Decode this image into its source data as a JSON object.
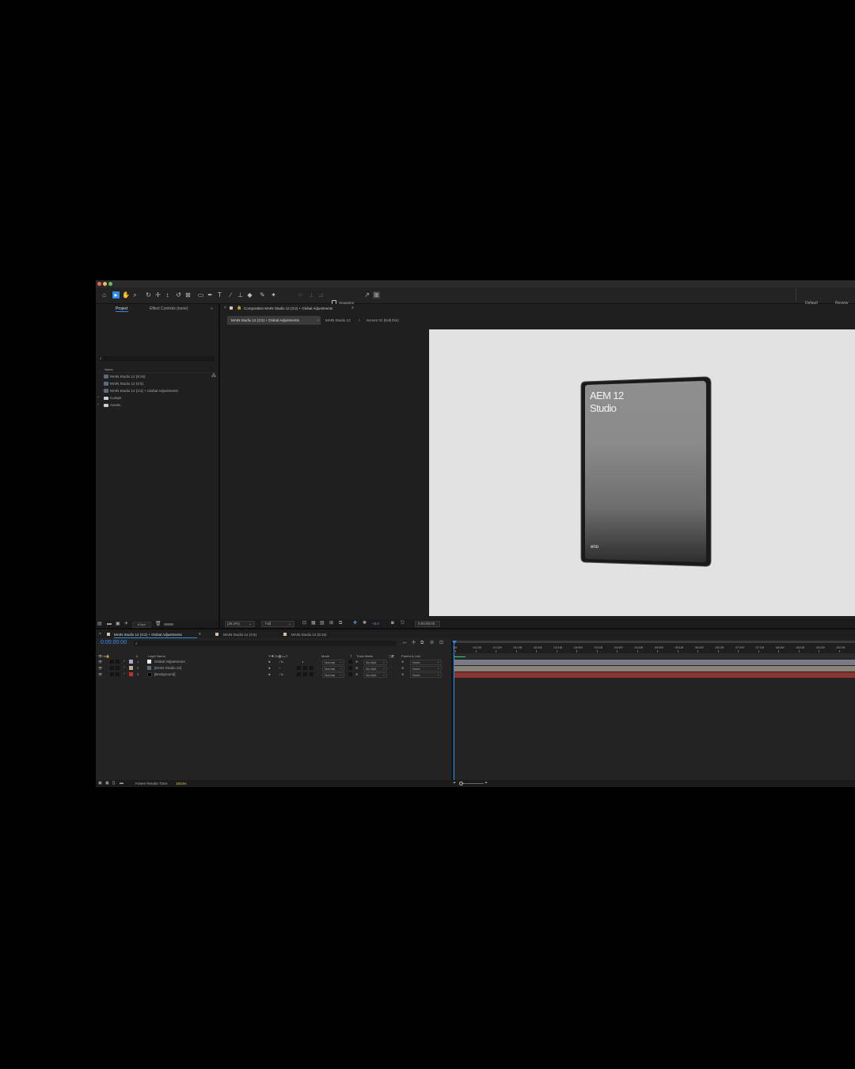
{
  "toolbar": {
    "snapping_label": "Snapping",
    "workspace_default": "Default",
    "workspace_review": "Review"
  },
  "project_panel": {
    "tab_project": "Project",
    "tab_effect_controls": "Effect Controls (none)",
    "search_placeholder": "",
    "column_name": "Name",
    "items": [
      {
        "name": "MAIN Studio 12 (9:16)",
        "type": "comp"
      },
      {
        "name": "MAIN Studio 12 (4:5)",
        "type": "comp"
      },
      {
        "name": "MAIN Studio 12 (3:2) + Global Adjustments",
        "type": "comp"
      },
      {
        "name": "Comps",
        "type": "folder"
      },
      {
        "name": "Assets",
        "type": "folder"
      }
    ],
    "bpc": "8 bpc"
  },
  "composition_panel": {
    "header": "Composition MAIN Studio 12 (3:2) + Global Adjustments",
    "breadcrumbs": [
      "MAIN Studio 12 (3:2) + Global Adjustments",
      "MAIN Studio 12",
      "Screen 01 (Edit this)"
    ],
    "zoom": "(28.2%)",
    "resolution": "Full",
    "timecode": "0:00:00:00",
    "exposure": "+0.0"
  },
  "canvas": {
    "title_line1": "AEM 12",
    "title_line2": "Studio",
    "logo": "eno",
    "background": "#e2e2e2"
  },
  "timeline": {
    "tabs": [
      "MAIN Studio 12 (3:2) + Global Adjustments",
      "MAIN Studio 12 (4:5)",
      "MAIN Studio 12 (9:16)"
    ],
    "timecode": "0:00:00:00",
    "columns": {
      "num": "#",
      "layer_name": "Layer Name",
      "mode": "Mode",
      "t": "T",
      "track_matte": "Track Matte",
      "parent": "Parent & Link"
    },
    "layers": [
      {
        "num": "1",
        "name": "Global Adjustments",
        "mode": "Normal",
        "matte": "No Mat",
        "parent": "None",
        "color": "#a8a8c8",
        "bar_color": "#7c7c88"
      },
      {
        "num": "2",
        "name": "[MAIN Studio 12]",
        "mode": "Normal",
        "matte": "No Mat",
        "parent": "None",
        "color": "#c8a890",
        "bar_color": "#8a8278"
      },
      {
        "num": "3",
        "name": "[Background]",
        "mode": "Normal",
        "matte": "No Mat",
        "parent": "None",
        "color": "#c03030",
        "bar_color": "#8a3434"
      }
    ],
    "ruler": [
      "00f",
      "00:15f",
      "01:00f",
      "01:15f",
      "02:00f",
      "02:15f",
      "03:00f",
      "03:15f",
      "04:00f",
      "04:15f",
      "05:00f",
      "05:15f",
      "06:00f",
      "06:15f",
      "07:00f",
      "07:15f",
      "08:00f",
      "08:15f",
      "09:00f",
      "09:15f"
    ],
    "render_time_label": "Frame Render Time:",
    "render_time_value": "181ms"
  }
}
